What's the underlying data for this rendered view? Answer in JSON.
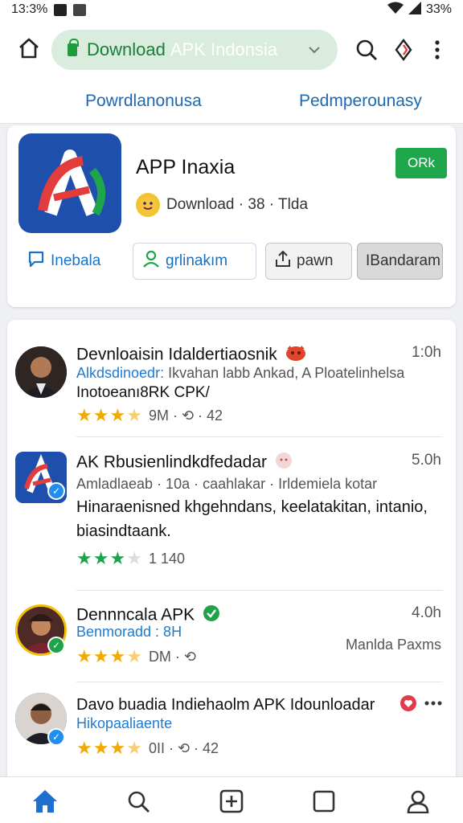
{
  "status": {
    "time": "13:3%",
    "battery": "33%"
  },
  "browser": {
    "url_main": "Download",
    "url_suffix": "APK Indonsia"
  },
  "tabs": [
    {
      "label": "Powrdlanonusa"
    },
    {
      "label": "Pedmperounasy"
    }
  ],
  "app": {
    "title": "APP Inaxia",
    "ok_label": "ORk",
    "meta": "Download · 38 · Tlda",
    "actions": [
      {
        "label": "Inebala",
        "icon": "chat-bubble-icon"
      },
      {
        "label": "grlinakım",
        "icon": "person-icon"
      },
      {
        "label": "pawn",
        "icon": "share-icon"
      },
      {
        "label": "IBandaram",
        "icon": ""
      }
    ]
  },
  "posts": [
    {
      "name": "Devnloaisin Idaldertiaosnik",
      "time": "1:0h",
      "sub_blue": "Alkdsdinoedr:",
      "sub": " Ikvahan labb Ankad, A Ploatelinhelsa",
      "body": "Inotoeanı8RK CPK/",
      "rating": 3.5,
      "star_color": "gold",
      "stats": "9M · ⟲ · 42"
    },
    {
      "name": "AK Rbusienlindkdfedadar",
      "time": "5.0h",
      "sub": "Amladlaeab · 10a · caahlakar · Irldemiela kotar",
      "body": "Hinaraenisned khgehndans, keelatakitan, intanio, biasindtaank.",
      "rating": 3,
      "star_color": "green",
      "stats": "1 140"
    },
    {
      "name": "Dennncala APK",
      "time": "4.0h",
      "sub_blue": "Benmoradd : 8H",
      "sub": "",
      "right_note": "Manlda Paxms",
      "rating": 3.5,
      "star_color": "gold",
      "stats": "DM · ⟲"
    },
    {
      "name": "Davo buadia Indiehaolm APK Idounloadar",
      "time": "",
      "sub_blue": "Hikopaaliaente",
      "sub": "",
      "rating": 3.5,
      "star_color": "gold",
      "stats": "0II · ⟲ · 42"
    }
  ],
  "colors": {
    "accent_blue": "#1b69b3",
    "green": "#1fa64a",
    "star": "#f2a900",
    "app_tile": "#1f4fad"
  }
}
